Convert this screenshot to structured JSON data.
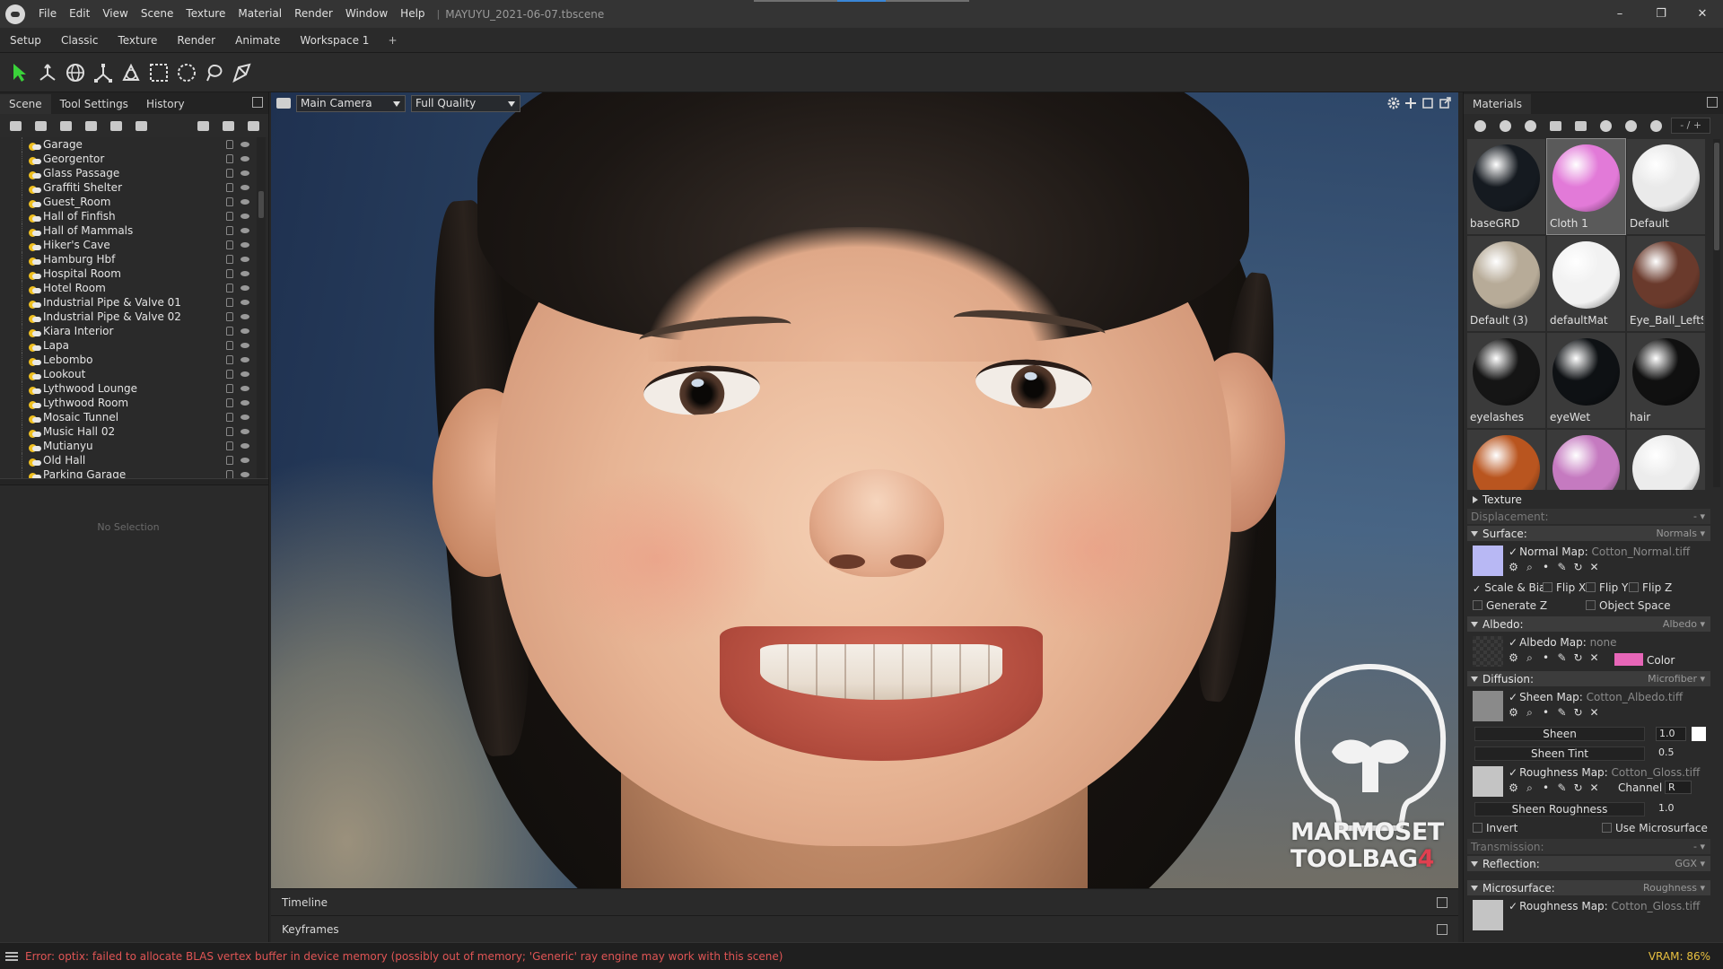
{
  "window": {
    "menu": [
      "File",
      "Edit",
      "View",
      "Scene",
      "Texture",
      "Material",
      "Render",
      "Window",
      "Help"
    ],
    "separator": "|",
    "title": "MAYUYU_2021-06-07.tbscene",
    "controls": {
      "minimize": "–",
      "restore": "❐",
      "close": "✕"
    }
  },
  "workspace_tabs": [
    "Setup",
    "Classic",
    "Texture",
    "Render",
    "Animate",
    "Workspace 1"
  ],
  "workspace_add": "+",
  "toolbar_icons": [
    "select-arrow-icon",
    "move-gizmo-icon",
    "rotate-gizmo-icon",
    "scale-gizmo-icon",
    "world-gizmo-icon",
    "marquee-select-icon",
    "circle-select-icon",
    "lasso-select-icon",
    "paint-select-icon"
  ],
  "left_panel": {
    "tabs": [
      "Scene",
      "Tool Settings",
      "History"
    ],
    "scene_items": [
      "Garage",
      "Georgentor",
      "Glass Passage",
      "Graffiti Shelter",
      "Guest_Room",
      "Hall of Finfish",
      "Hall of Mammals",
      "Hiker's Cave",
      "Hamburg Hbf",
      "Hospital Room",
      "Hotel Room",
      "Industrial Pipe & Valve 01",
      "Industrial Pipe & Valve 02",
      "Kiara Interior",
      "Lapa",
      "Lebombo",
      "Lookout",
      "Lythwood Lounge",
      "Lythwood Room",
      "Mosaic Tunnel",
      "Music Hall 02",
      "Mutianyu",
      "Old Hall",
      "Parking Garage"
    ],
    "no_selection": "No Selection"
  },
  "viewport": {
    "camera": "Main Camera",
    "quality": "Full Quality",
    "logo_line1": "MARMOSET",
    "logo_line2": "TOOLBAG",
    "logo_version": "4"
  },
  "timeline": {
    "timeline_label": "Timeline",
    "keyframes_label": "Keyframes"
  },
  "materials": {
    "tab": "Materials",
    "page": "- / +",
    "items": [
      {
        "name": "baseGRD",
        "color": "#151a20"
      },
      {
        "name": "Cloth 1",
        "color": "#e27ad8",
        "selected": true
      },
      {
        "name": "Default",
        "color": "#eaeaea"
      },
      {
        "name": "Default (3)",
        "color": "#b7ab98"
      },
      {
        "name": "defaultMat",
        "color": "#f2f2f2"
      },
      {
        "name": "Eye_Ball_LeftSG",
        "color": "#6a3a2c"
      },
      {
        "name": "eyelashes",
        "color": "#151515"
      },
      {
        "name": "eyeWet",
        "color": "#0e1114"
      },
      {
        "name": "hair",
        "color": "#101010"
      },
      {
        "name": "",
        "color": "#b9551f"
      },
      {
        "name": "",
        "color": "#c57ac0"
      },
      {
        "name": "",
        "color": "#ececec"
      }
    ]
  },
  "properties": {
    "texture": "Texture",
    "displacement": {
      "label": "Displacement:",
      "value": "-"
    },
    "surface": {
      "label": "Surface:",
      "value": "Normals"
    },
    "normal_map": {
      "label": "Normal Map:",
      "file": "Cotton_Normal.tiff",
      "swatch": "#b8b8f4"
    },
    "scale_bias": "Scale & Bias",
    "flip_x": "Flip X",
    "flip_y": "Flip Y",
    "flip_z": "Flip Z",
    "generate_z": "Generate Z",
    "object_space": "Object Space",
    "albedo": {
      "label": "Albedo:",
      "value": "Albedo"
    },
    "albedo_map": {
      "label": "Albedo Map:",
      "file": "none",
      "color_label": "Color"
    },
    "diffusion": {
      "label": "Diffusion:",
      "value": "Microfiber"
    },
    "sheen_map": {
      "label": "Sheen Map:",
      "file": "Cotton_Albedo.tiff",
      "swatch": "#8a8a8a"
    },
    "sheen": {
      "label": "Sheen",
      "value": "1.0"
    },
    "sheen_tint": {
      "label": "Sheen Tint",
      "value": "0.5"
    },
    "roughness_map": {
      "label": "Roughness Map:",
      "file": "Cotton_Gloss.tiff",
      "channel_label": "Channel",
      "channel": "R",
      "swatch": "#c4c4c4"
    },
    "sheen_roughness": {
      "label": "Sheen Roughness",
      "value": "1.0"
    },
    "invert": "Invert",
    "use_microsurface": "Use Microsurface",
    "transmission": {
      "label": "Transmission:",
      "value": "-"
    },
    "reflection": {
      "label": "Reflection:",
      "value": "GGX"
    },
    "microsurface": {
      "label": "Microsurface:",
      "value": "Roughness"
    },
    "roughness_map2": {
      "label": "Roughness Map:",
      "file": "Cotton_Gloss.tiff"
    }
  },
  "status": {
    "error": "Error: optix: failed to allocate BLAS vertex buffer in device memory (possibly out of memory; 'Generic' ray engine may work with this scene)",
    "vram": "VRAM: 86%"
  }
}
